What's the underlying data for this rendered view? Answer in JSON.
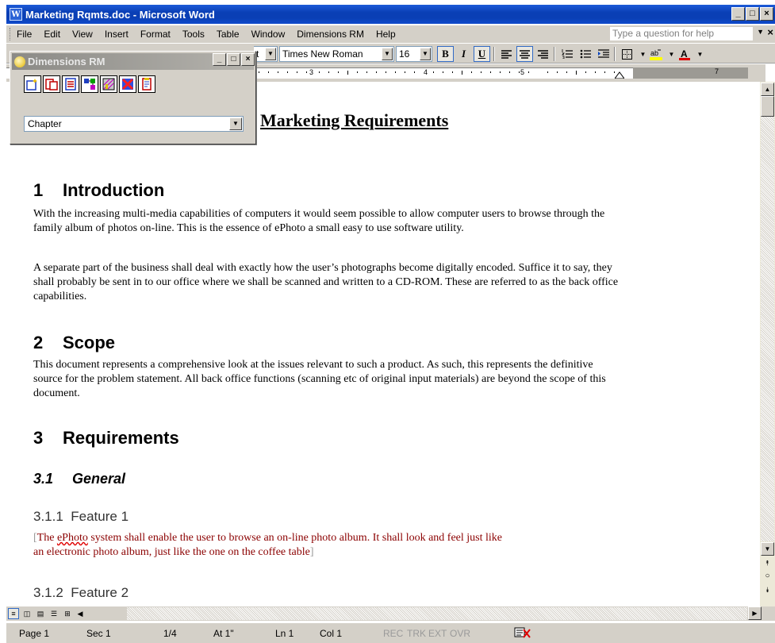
{
  "window": {
    "title": "Marketing Rqmts.doc - Microsoft Word",
    "app_icon": "word-doc-icon",
    "buttons": [
      "minimize",
      "maximize",
      "close"
    ]
  },
  "menu": {
    "items": [
      "File",
      "Edit",
      "View",
      "Insert",
      "Format",
      "Tools",
      "Table",
      "Window",
      "Dimensions RM",
      "Help"
    ],
    "help_placeholder": "Type a question for help",
    "close_label": "×"
  },
  "toolbar": {
    "style_partial": "t",
    "font": "Times New Roman",
    "size": "16",
    "bold_label": "B",
    "italic_label": "I",
    "underline_label": "U",
    "align_center_pressed": true
  },
  "ruler": {
    "numbers": [
      "3",
      "4",
      "5",
      "7"
    ]
  },
  "palette": {
    "title": "Dimensions RM",
    "icons": [
      "new-requirement-icon",
      "new-child-icon",
      "list-view-icon",
      "relationship-icon",
      "chart-icon",
      "delete-icon",
      "document-icon"
    ],
    "select_value": "Chapter"
  },
  "document": {
    "title": "Marketing Requirements",
    "sections": [
      {
        "number": "1",
        "heading": "Introduction",
        "paragraphs": [
          "With the increasing multi-media capabilities of computers it would seem possible to allow computer users to browse through the family album of photos on-line. This is the essence of ePhoto a small easy to use software utility.",
          "A separate part of the business shall deal with exactly how the user’s photographs become digitally encoded. Suffice it to say, they shall probably be sent in to our office where we shall be scanned and written to a CD-ROM. These are referred to as the back office capabilities."
        ]
      },
      {
        "number": "2",
        "heading": "Scope",
        "paragraphs": [
          "This document represents a comprehensive look at the issues relevant to such a product. As such, this represents the definitive source for the problem statement. All back office functions (scanning etc of original input materials) are beyond the scope of this document."
        ]
      },
      {
        "number": "3",
        "heading": "Requirements",
        "subsection": {
          "number": "3.1",
          "heading": "General",
          "features": [
            {
              "number": "3.1.1",
              "heading": "Feature 1",
              "text_start": "The ",
              "text_marked": "ePhoto",
              "text_rest_line1": " system shall enable the user to browse an on-line photo album. It shall look and feel just like",
              "text_line2": "an electronic photo album, just like the one on the coffee table"
            },
            {
              "number": "3.1.2",
              "heading": "Feature 2"
            }
          ]
        }
      }
    ]
  },
  "status": {
    "page": "Page 1",
    "sec": "Sec 1",
    "pages": "1/4",
    "at": "At 1\"",
    "ln": "Ln 1",
    "col": "Col 1",
    "rec": "REC",
    "trk": "TRK",
    "ext": "EXT",
    "ovr": "OVR"
  },
  "colors": {
    "titlebar": "#0a3fb5",
    "chrome": "#d4d0c8",
    "requirement_text": "#8b0000"
  }
}
